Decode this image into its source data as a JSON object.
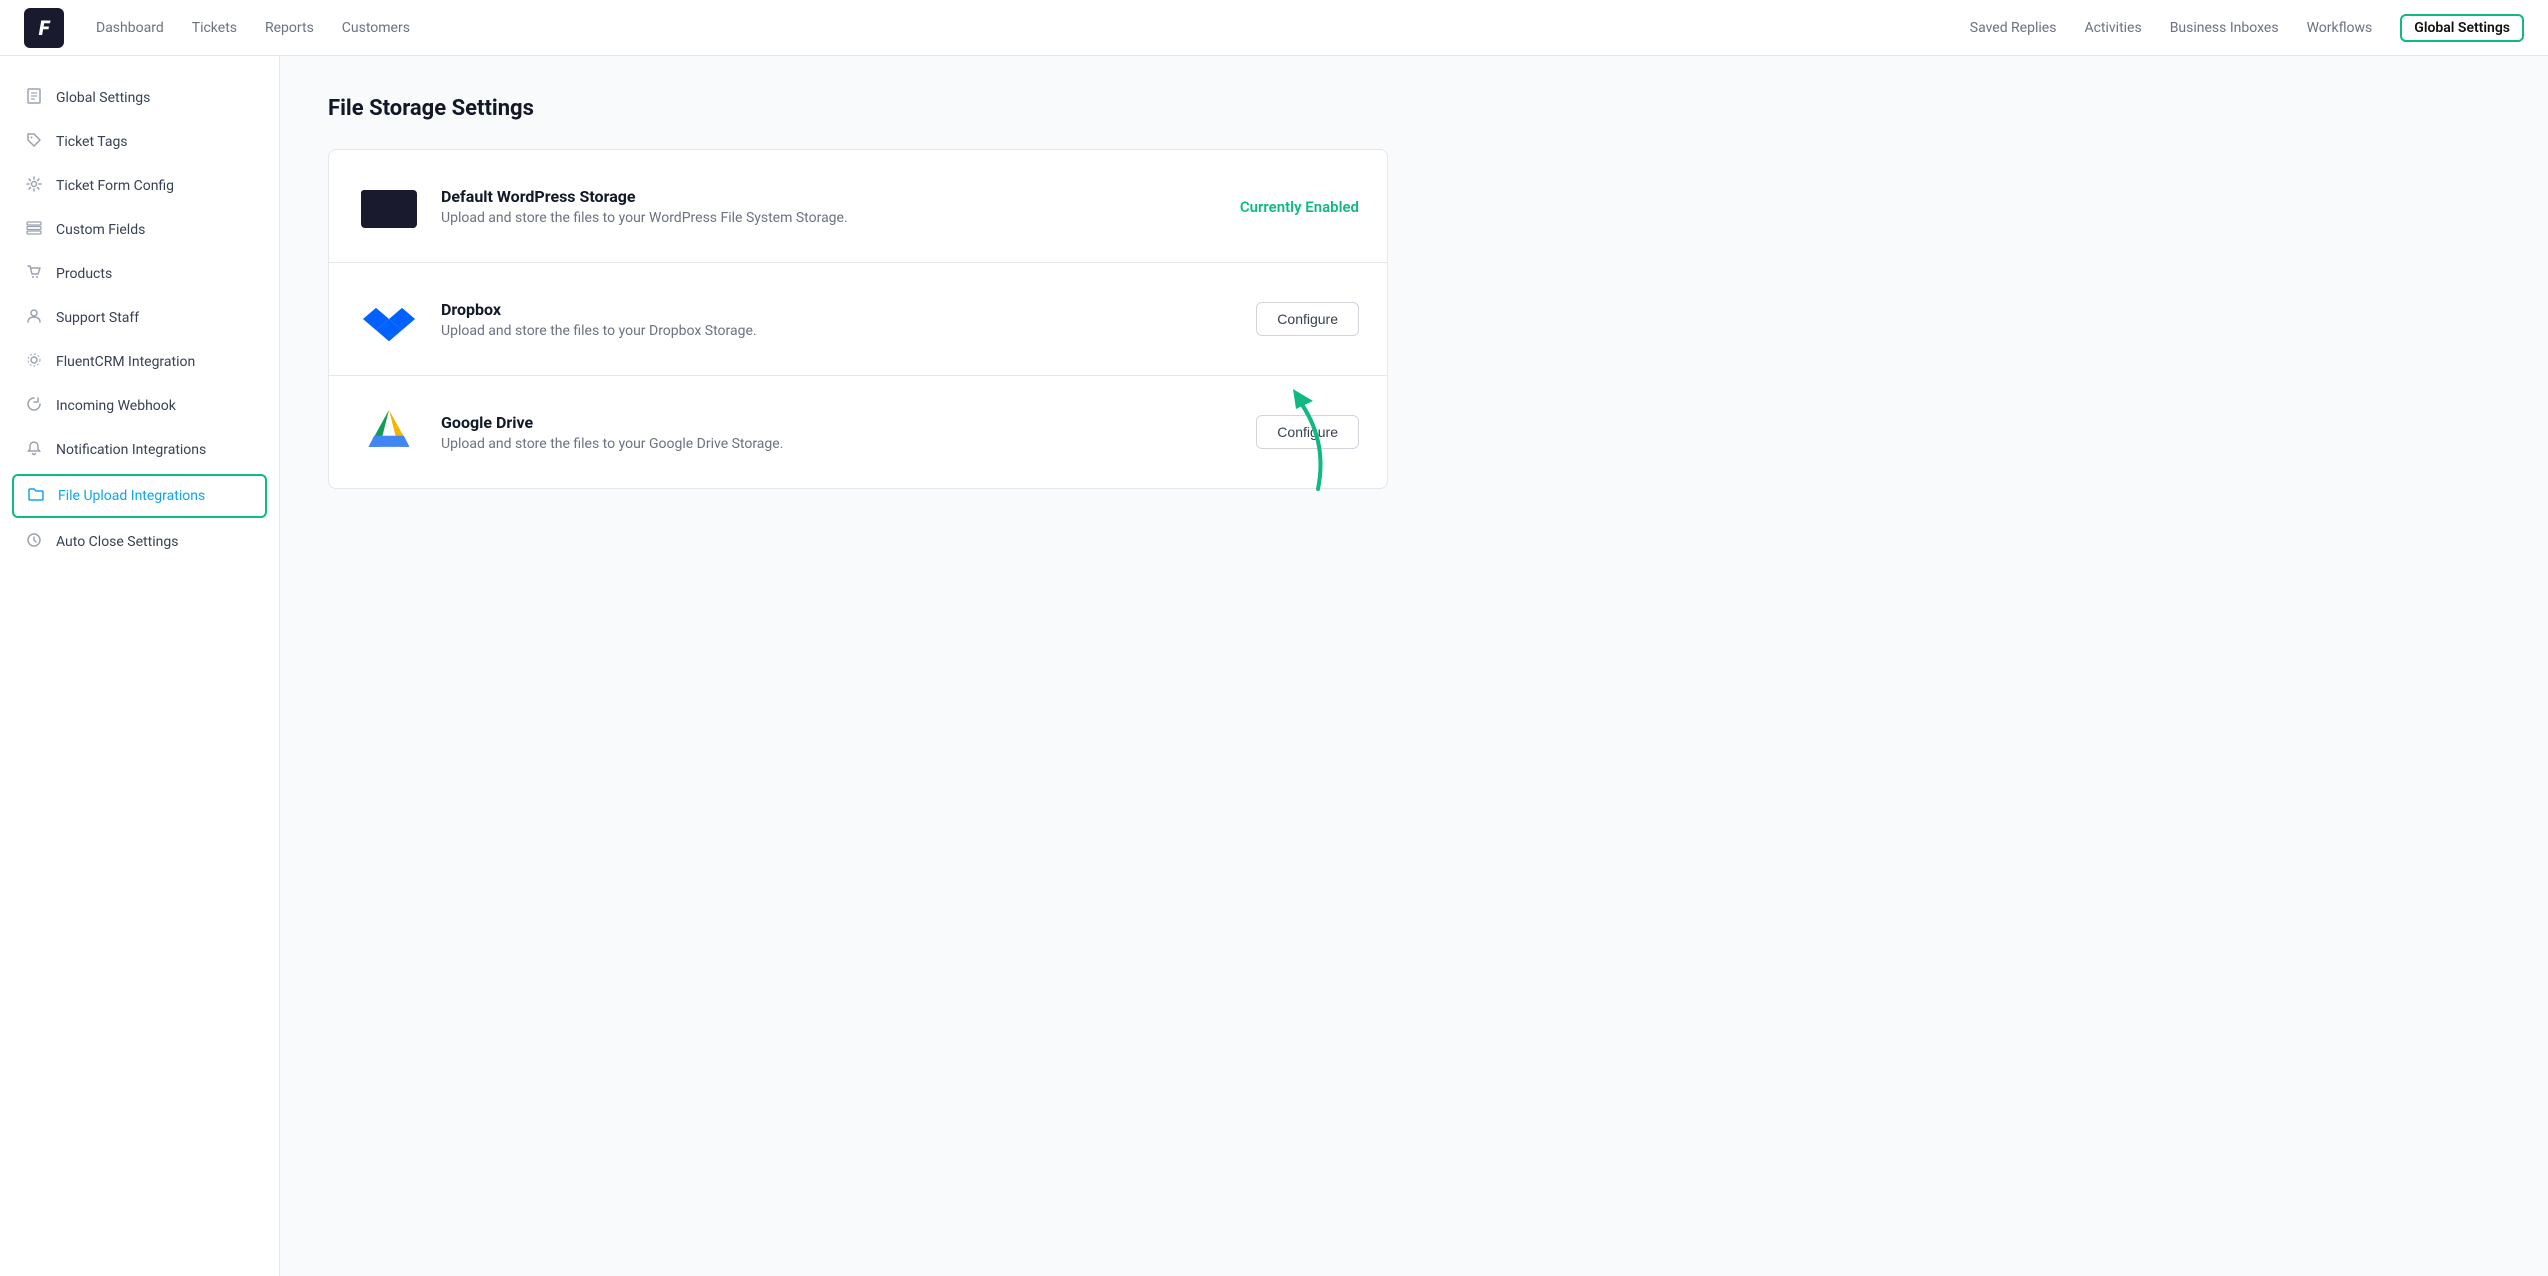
{
  "nav": {
    "logo": "F",
    "left_items": [
      {
        "label": "Dashboard",
        "active": false
      },
      {
        "label": "Tickets",
        "active": false
      },
      {
        "label": "Reports",
        "active": false
      },
      {
        "label": "Customers",
        "active": false
      }
    ],
    "right_items": [
      {
        "label": "Saved Replies",
        "active": false
      },
      {
        "label": "Activities",
        "active": false
      },
      {
        "label": "Business Inboxes",
        "active": false
      },
      {
        "label": "Workflows",
        "active": false
      },
      {
        "label": "Global Settings",
        "active": true
      }
    ]
  },
  "sidebar": {
    "items": [
      {
        "label": "Global Settings",
        "icon": "📄",
        "active": false
      },
      {
        "label": "Ticket Tags",
        "icon": "🔖",
        "active": false
      },
      {
        "label": "Ticket Form Config",
        "icon": "⚙️",
        "active": false
      },
      {
        "label": "Custom Fields",
        "icon": "📋",
        "active": false
      },
      {
        "label": "Products",
        "icon": "🛍️",
        "active": false
      },
      {
        "label": "Support Staff",
        "icon": "👤",
        "active": false
      },
      {
        "label": "FluentCRM Integration",
        "icon": "⚙️",
        "active": false
      },
      {
        "label": "Incoming Webhook",
        "icon": "🔗",
        "active": false
      },
      {
        "label": "Notification Integrations",
        "icon": "🔔",
        "active": false
      },
      {
        "label": "File Upload Integrations",
        "icon": "📁",
        "active": true
      },
      {
        "label": "Auto Close Settings",
        "icon": "⏱️",
        "active": false
      }
    ]
  },
  "page": {
    "title": "File Storage Settings"
  },
  "storage_options": [
    {
      "id": "wordpress",
      "name": "Default WordPress Storage",
      "description": "Upload and store the files to your WordPress File System Storage.",
      "action_type": "status",
      "action_label": "Currently Enabled"
    },
    {
      "id": "dropbox",
      "name": "Dropbox",
      "description": "Upload and store the files to your Dropbox Storage.",
      "action_type": "button",
      "action_label": "Configure"
    },
    {
      "id": "google_drive",
      "name": "Google Drive",
      "description": "Upload and store the files to your Google Drive Storage.",
      "action_type": "button",
      "action_label": "Configure"
    }
  ],
  "colors": {
    "enabled": "#10b981",
    "active_border": "#10b981",
    "active_text": "#0ea5e9",
    "arrow": "#10b981"
  }
}
